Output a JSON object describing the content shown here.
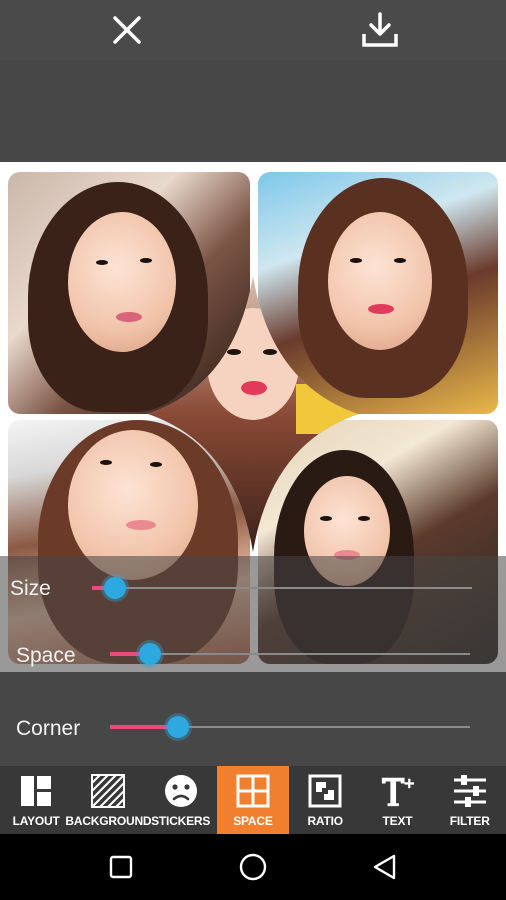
{
  "topbar": {
    "close_icon": "close-icon",
    "download_icon": "download-icon"
  },
  "collage": {
    "photos": [
      "photo-top-left",
      "photo-top-right",
      "photo-bottom-left",
      "photo-bottom-right",
      "photo-center"
    ]
  },
  "controls": {
    "size": {
      "label": "Size",
      "value": 0.06
    },
    "space": {
      "label": "Space",
      "value": 0.11
    },
    "corner": {
      "label": "Corner",
      "value": 0.19
    }
  },
  "toolbar": {
    "items": [
      {
        "label": "LAYOUT",
        "icon": "layout-icon"
      },
      {
        "label": "BACKGROUND",
        "icon": "background-icon"
      },
      {
        "label": "STICKERS",
        "icon": "stickers-icon"
      },
      {
        "label": "SPACE",
        "icon": "space-icon"
      },
      {
        "label": "RATIO",
        "icon": "ratio-icon"
      },
      {
        "label": "TEXT",
        "icon": "text-icon"
      },
      {
        "label": "FILTER",
        "icon": "filter-icon"
      }
    ],
    "active": "SPACE"
  },
  "navbar": {
    "recent_icon": "recent-apps-icon",
    "home_icon": "home-icon",
    "back_icon": "back-icon"
  },
  "colors": {
    "accent": "#f07f2f",
    "slider_fill": "#ec4a7c",
    "slider_thumb": "#2ea9e0"
  }
}
